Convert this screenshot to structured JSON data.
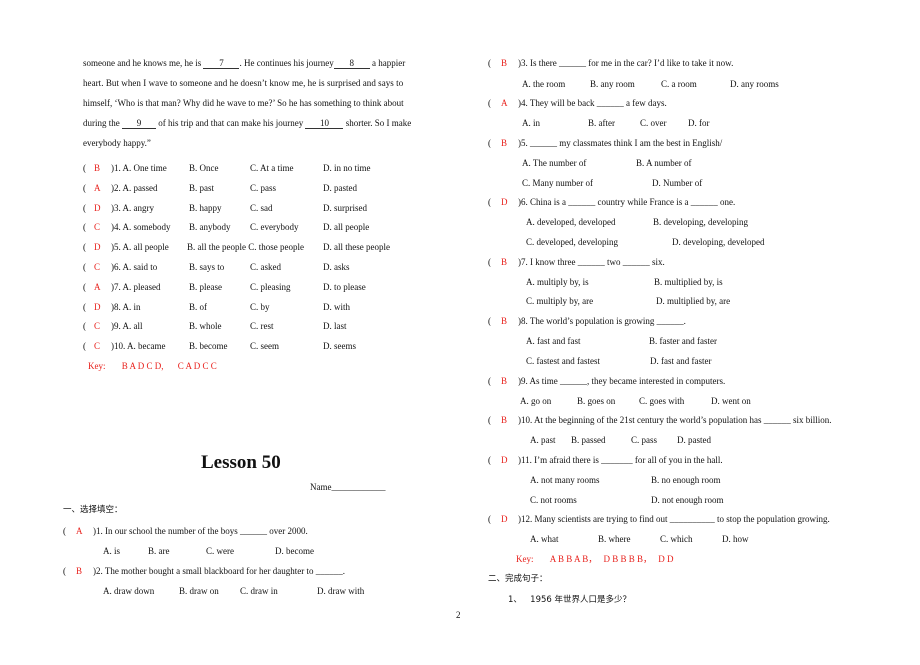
{
  "passage": {
    "line1": {
      "pre": "someone and he knows me, he is ",
      "blank1": "7",
      "mid": ". He continues his journey",
      "blank2": "8",
      "post": " a happier"
    },
    "line2": "heart. But when I wave to someone and he doesn’t know me, he is surprised and says to",
    "line3": "himself, ‘Who is that man? Why did he wave to me?’ So he has something to think about",
    "line4": {
      "pre": "during the ",
      "blank1": "9",
      "mid": " of his trip and that can make his journey ",
      "blank2": "10",
      "post": " shorter. So I make"
    },
    "line5": "everybody happy.”"
  },
  "cloze": [
    {
      "ans": "B",
      "num": ")1. A. One time",
      "b": "B.    Once",
      "c": "C.    At a time",
      "d": "D. in no time"
    },
    {
      "ans": "A",
      "num": ")2. A. passed",
      "b": "B.    past",
      "c": "C.    pass",
      "d": "D. pasted"
    },
    {
      "ans": "D",
      "num": ")3. A. angry",
      "b": "B.    happy",
      "c": "C.    sad",
      "d": "D. surprised"
    },
    {
      "ans": "C",
      "num": ")4. A. somebody",
      "b": "B. anybody",
      "c": "C. everybody",
      "d": "D. all people"
    },
    {
      "ans": "D",
      "num": ")5. A. all people",
      "b": "B. all the people C. those people",
      "c": "",
      "d": "D. all these people"
    },
    {
      "ans": "C",
      "num": ")6. A. said to",
      "b": "B. says to",
      "c": "C. asked",
      "d": "D. asks"
    },
    {
      "ans": "A",
      "num": ")7. A. pleased",
      "b": "B. please",
      "c": "C. pleasing",
      "d": "D. to please"
    },
    {
      "ans": "D",
      "num": ")8. A. in",
      "b": "B. of",
      "c": "C. by",
      "d": "D. with"
    },
    {
      "ans": "C",
      "num": ")9. A. all",
      "b": "B. whole",
      "c": "C. rest",
      "d": "D. last"
    },
    {
      "ans": "C",
      "num": ")10. A. became",
      "b": "B. become",
      "c": "C. seem",
      "d": "D. seems"
    }
  ],
  "cloze_key": {
    "label": "Key:",
    "part1": "B A D C D,",
    "part2": "C A D C C"
  },
  "lesson": {
    "title": "Lesson 50",
    "name_label": "Name____________",
    "section1": "一、选择填空：",
    "section2": "二、完成句子：",
    "sentence1": {
      "num": "1、",
      "text": "1956 年世界人口是多少？"
    }
  },
  "mc": [
    {
      "ans": "A",
      "q": ")1. In our school the number of the boys ______ over 2000.",
      "opts": [
        "A. is",
        "B.    are",
        "C.    were",
        "D. become"
      ]
    },
    {
      "ans": "B",
      "q": ")2. The mother bought a small blackboard for her daughter to ______.",
      "opts": [
        "A. draw down",
        "B. draw on",
        "C.    draw in",
        "D. draw with"
      ]
    },
    {
      "ans": "B",
      "q": ")3. Is there ______ for me in the car? I’d like to take it now.",
      "opts": [
        "A. the room",
        "B. any room",
        "C.    a room",
        "D. any rooms"
      ]
    },
    {
      "ans": "A",
      "q": ")4. They will be back ______ a few days.",
      "opts": [
        "A. in",
        "B. after",
        "C. over",
        "D. for"
      ]
    },
    {
      "ans": "B",
      "q": ")5. ______ my classmates think I am the best in English/",
      "opts": [
        "A. The number of",
        "B.    A number of",
        "C. Many number of",
        "D.    Number of"
      ]
    },
    {
      "ans": "D",
      "q": ")6. China is a ______ country while France is a ______ one.",
      "opts": [
        "A. developed, developed",
        "B. developing, developing",
        "C. developed,    developing",
        "D. developing, developed"
      ]
    },
    {
      "ans": "B",
      "q": ")7. I know three ______ two ______ six.",
      "opts": [
        "A. multiply by, is",
        "B.    multiplied by, is",
        "C. multiply by,    are",
        "D. multiplied by,    are"
      ]
    },
    {
      "ans": "B",
      "q": ")8. The world’s population is growing ______.",
      "opts": [
        "A. fast and fast",
        "B. faster and faster",
        "C. fastest and fastest",
        "D. fast and faster"
      ]
    },
    {
      "ans": "B",
      "q": ")9. As time ______, they became interested in computers.",
      "opts": [
        "A. go on",
        "B. goes on",
        "C.    goes with",
        "D. went on"
      ]
    },
    {
      "ans": "B",
      "q": ")10. At the beginning of the 21st century the world’s population has ______ six billion.",
      "opts": [
        "A. past",
        "B. passed",
        "C. pass",
        "D. pasted"
      ]
    },
    {
      "ans": "D",
      "q": ")11. I’m afraid there is _______ for all of you in the hall.",
      "opts": [
        "A. not many rooms",
        "B. no enough room",
        "C. not rooms",
        "D. not enough room"
      ]
    },
    {
      "ans": "D",
      "q": ")12. Many scientists are trying to find out __________ to stop the population growing.",
      "opts": [
        "A. what",
        "B. where",
        "C. which",
        "D. how"
      ]
    }
  ],
  "mc_key": {
    "label": "Key:",
    "part1": "A B B A B，",
    "part2": "D B B B B，",
    "part3": "D D"
  },
  "page_number": "2"
}
